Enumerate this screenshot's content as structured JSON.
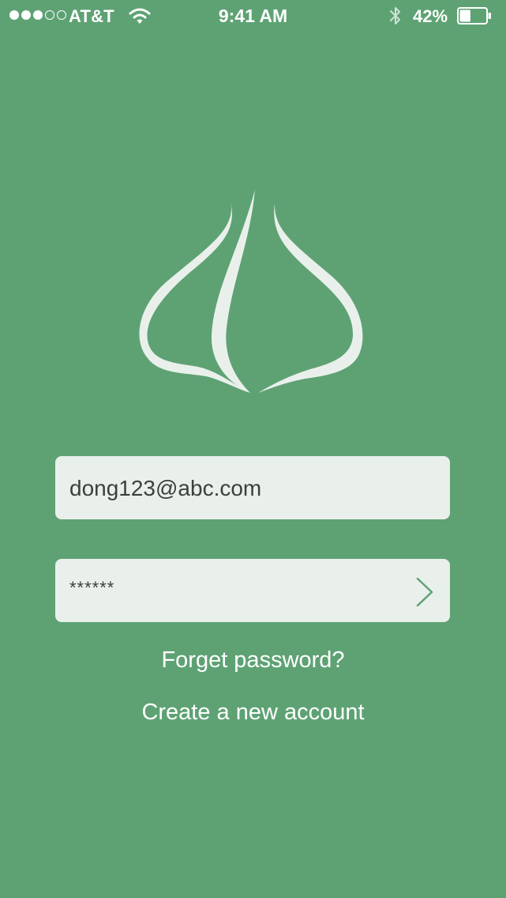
{
  "status_bar": {
    "carrier": "AT&T",
    "signal_bars_filled": 3,
    "signal_bars_total": 5,
    "wifi_icon": "wifi-icon",
    "time": "9:41 AM",
    "bluetooth_icon": "bluetooth-icon",
    "battery_percent_label": "42%",
    "battery_level": 0.42
  },
  "logo": {
    "icon": "garlic-leaf-logo"
  },
  "login_form": {
    "email_value": "dong123@abc.com",
    "password_value": "******",
    "submit_icon": "chevron-right-icon"
  },
  "links": {
    "forgot_password": "Forget password?",
    "create_account": "Create a new account"
  },
  "colors": {
    "background": "#5ea274",
    "field_background": "#e9f0eb",
    "field_text": "#3b3f3d",
    "logo": "#e9f0eb",
    "text": "#ffffff"
  }
}
